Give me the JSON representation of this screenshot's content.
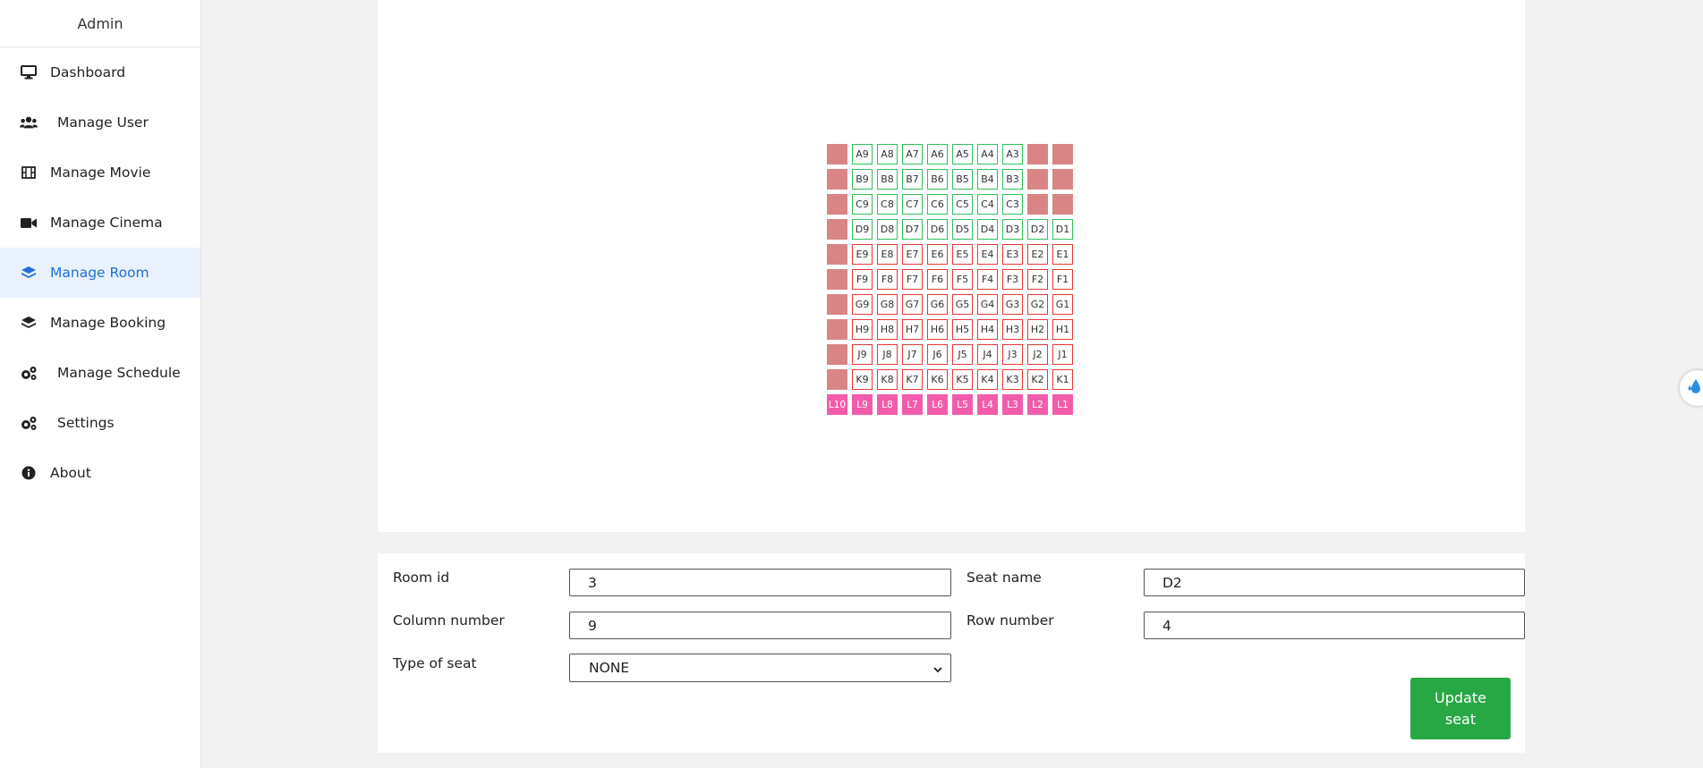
{
  "app": {
    "title": "Admin"
  },
  "sidebar": {
    "items": [
      {
        "label": "Dashboard",
        "icon": "monitor-icon",
        "active": false
      },
      {
        "label": "Manage User",
        "icon": "users-icon",
        "active": false
      },
      {
        "label": "Manage Movie",
        "icon": "film-icon",
        "active": false
      },
      {
        "label": "Manage Cinema",
        "icon": "video-camera-icon",
        "active": false
      },
      {
        "label": "Manage Room",
        "icon": "layers-icon",
        "active": true
      },
      {
        "label": "Manage Booking",
        "icon": "layers-icon",
        "active": false
      },
      {
        "label": "Manage Schedule",
        "icon": "gears-icon",
        "active": false
      },
      {
        "label": "Settings",
        "icon": "gears-icon",
        "active": false
      },
      {
        "label": "About",
        "icon": "info-circle-icon",
        "active": false
      }
    ]
  },
  "seat_map": {
    "colors": {
      "green": "#2fbf5a",
      "red": "#e53935",
      "blocked": "#d98585",
      "pink": "#f25cab"
    },
    "rows": [
      [
        "",
        "A9",
        "A8",
        "A7",
        "A6",
        "A5",
        "A4",
        "A3",
        "",
        ""
      ],
      [
        "",
        "B9",
        "B8",
        "B7",
        "B6",
        "B5",
        "B4",
        "B3",
        "",
        ""
      ],
      [
        "",
        "C9",
        "C8",
        "C7",
        "C6",
        "C5",
        "C4",
        "C3",
        "",
        ""
      ],
      [
        "",
        "D9",
        "D8",
        "D7",
        "D6",
        "D5",
        "D4",
        "D3",
        "D2",
        "D1"
      ],
      [
        "",
        "E9",
        "E8",
        "E7",
        "E6",
        "E5",
        "E4",
        "E3",
        "E2",
        "E1"
      ],
      [
        "",
        "F9",
        "F8",
        "F7",
        "F6",
        "F5",
        "F4",
        "F3",
        "F2",
        "F1"
      ],
      [
        "",
        "G9",
        "G8",
        "G7",
        "G6",
        "G5",
        "G4",
        "G3",
        "G2",
        "G1"
      ],
      [
        "",
        "H9",
        "H8",
        "H7",
        "H6",
        "H5",
        "H4",
        "H3",
        "H2",
        "H1"
      ],
      [
        "",
        "J9",
        "J8",
        "J7",
        "J6",
        "J5",
        "J4",
        "J3",
        "J2",
        "J1"
      ],
      [
        "",
        "K9",
        "K8",
        "K7",
        "K6",
        "K5",
        "K4",
        "K3",
        "K2",
        "K1"
      ],
      [
        "L10",
        "L9",
        "L8",
        "L7",
        "L6",
        "L5",
        "L4",
        "L3",
        "L2",
        "L1"
      ]
    ],
    "types": [
      [
        "b",
        "g",
        "g",
        "g",
        "g",
        "g",
        "g",
        "g",
        "b",
        "b"
      ],
      [
        "b",
        "g",
        "g",
        "g",
        "g",
        "g",
        "g",
        "g",
        "b",
        "b"
      ],
      [
        "b",
        "g",
        "g",
        "g",
        "g",
        "g",
        "g",
        "g",
        "b",
        "b"
      ],
      [
        "b",
        "g",
        "g",
        "g",
        "g",
        "g",
        "g",
        "g",
        "g",
        "g"
      ],
      [
        "b",
        "r",
        "r",
        "r",
        "r",
        "r",
        "r",
        "r",
        "r",
        "r"
      ],
      [
        "b",
        "r",
        "r",
        "r",
        "r",
        "r",
        "r",
        "r",
        "r",
        "r"
      ],
      [
        "b",
        "r",
        "r",
        "r",
        "r",
        "r",
        "r",
        "r",
        "r",
        "r"
      ],
      [
        "b",
        "r",
        "r",
        "r",
        "r",
        "r",
        "r",
        "r",
        "r",
        "r"
      ],
      [
        "b",
        "r",
        "r",
        "r",
        "r",
        "r",
        "r",
        "r",
        "r",
        "r"
      ],
      [
        "b",
        "r",
        "r",
        "r",
        "r",
        "r",
        "r",
        "r",
        "r",
        "r"
      ],
      [
        "p",
        "p",
        "p",
        "p",
        "p",
        "p",
        "p",
        "p",
        "p",
        "p"
      ]
    ]
  },
  "form": {
    "room_id_label": "Room id",
    "room_id_value": "3",
    "seat_name_label": "Seat name",
    "seat_name_value": "D2",
    "column_number_label": "Column number",
    "column_number_value": "9",
    "row_number_label": "Row number",
    "row_number_value": "4",
    "type_of_seat_label": "Type of seat",
    "type_of_seat_value": "NONE",
    "update_button_label": "Update seat"
  },
  "floating_widget": {
    "icon": "water-drop-icon"
  }
}
